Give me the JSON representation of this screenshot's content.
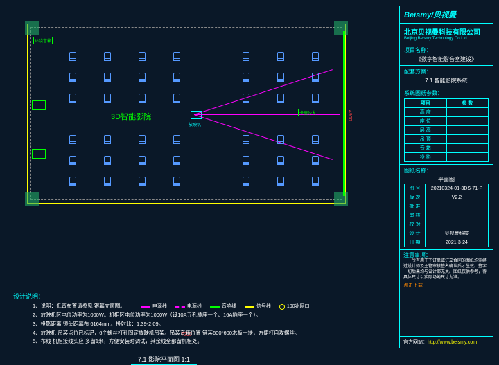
{
  "logo": "Beismy/贝视曼",
  "company": {
    "cn": "北京贝视曼科技有限公司",
    "en": "Beijing Beismy Technology Co.Ltd."
  },
  "project": {
    "title": "项目名称：",
    "value": "《数字智能影音室建设》"
  },
  "scheme": {
    "title": "配套方案：",
    "value": "7.1 智能影院系统"
  },
  "params_title": "系统图纸参数：",
  "params_headers": {
    "item": "项目",
    "val": "参 数"
  },
  "params": [
    "高 度",
    "座 位",
    "层 高",
    "吊 顶",
    "音 箱",
    "投 影"
  ],
  "draw_name": {
    "title": "图纸名称：",
    "value": "平面图"
  },
  "info": {
    "tuhao_l": "图 号",
    "tuhao_v": "20210324-01-3DS-71-P",
    "banchi_l": "版 次",
    "banchi_v": "V2.2",
    "pizhun_l": "批 准",
    "pizhun_v": "",
    "shenhe_l": "审 核",
    "shenhe_v": "",
    "xiaodui_l": "校 对",
    "xiaodui_v": "",
    "sheji_l": "设 计",
    "sheji_v": "贝视曼科技",
    "riqi_l": "日 期",
    "riqi_v": "2021-3-24"
  },
  "notice": {
    "title": "注意事项：",
    "text": "所有用于下订单或订立合同的图纸均需经过设计师及主管审核签名确认后才生效。签字一切后果均与设计部无关。图纸仅供参考，待具体尺寸以实际场地尺寸为准。",
    "dl": "点击下载"
  },
  "footer": {
    "label": "官方网站：",
    "url": "http://www.beismy.com"
  },
  "plan": {
    "room_label": "3D智能影院",
    "proj_label": "放映机",
    "dim_w": "7200",
    "dim_h": "4900",
    "title": "7.1  影院平面图  1:1",
    "tag_left": "环绕音箱",
    "tag_right": "卡座沙发"
  },
  "notes": {
    "title": "设计说明：",
    "n1": "1、说明：低音布置请参见   银幕立面图。",
    "n2": "2、放映机区电位功率为1000W。机柜区电位功率为1000W（设10A五孔插座一个、16A插座一个）。",
    "n3": "3、投影距离 镜头距幕布 6164mm。投射比：1.39-2.09。",
    "n4": "4、放映机 吊装点位已标记，6个螺丝打孔固定放映机吊架。吊装音箱位置 铺装600*600木板一块，方便打自攻螺丝。",
    "n5": "5、布线 机柜接线头应 多留1米，方便安装时调试，其余线全部留机柜处。",
    "legend": {
      "l1": "电源线",
      "l2": "电源线",
      "l3": "音响线",
      "l4": "信号线",
      "l5": "100兆网口"
    }
  }
}
